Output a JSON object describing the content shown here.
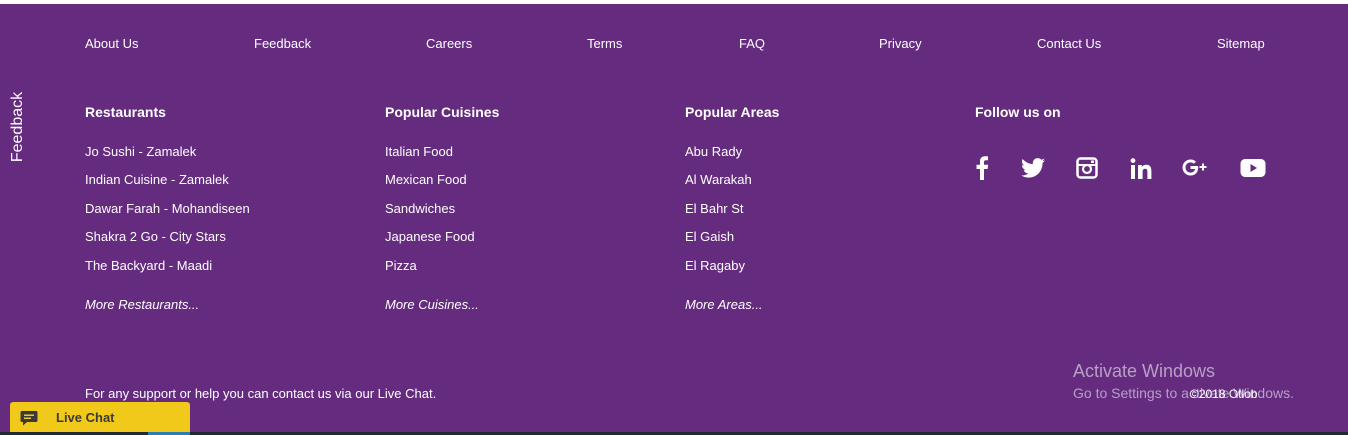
{
  "top_nav": [
    "About Us",
    "Feedback",
    "Careers",
    "Terms",
    "FAQ",
    "Privacy",
    "Contact Us",
    "Sitemap"
  ],
  "feedback_tab": "Feedback",
  "columns": [
    {
      "title": "Restaurants",
      "items": [
        "Jo Sushi - Zamalek",
        "Indian Cuisine - Zamalek",
        "Dawar Farah - Mohandiseen",
        "Shakra 2 Go - City Stars",
        "The Backyard - Maadi"
      ],
      "more": "More Restaurants..."
    },
    {
      "title": "Popular Cuisines",
      "items": [
        "Italian Food",
        "Mexican Food",
        "Sandwiches",
        "Japanese Food",
        "Pizza"
      ],
      "more": "More Cuisines..."
    },
    {
      "title": "Popular Areas",
      "items": [
        "Abu Rady",
        "Al Warakah",
        "El Bahr St",
        "El Gaish",
        "El Ragaby"
      ],
      "more": "More Areas..."
    }
  ],
  "follow": {
    "title": "Follow us on",
    "icons": [
      "facebook-icon",
      "twitter-icon",
      "instagram-icon",
      "linkedin-icon",
      "google-plus-icon",
      "youtube-icon"
    ]
  },
  "support_text": "For any support or help you can contact us via our Live Chat.",
  "activate_windows": {
    "title": "Activate Windows",
    "subtitle": "Go to Settings to activate Windows."
  },
  "copyright": "©2018 Otlob",
  "live_chat": {
    "label": "Live Chat"
  },
  "colors": {
    "footer_bg": "#642b7f",
    "live_chat_bg": "#f0c91a",
    "text": "#ffffff"
  }
}
